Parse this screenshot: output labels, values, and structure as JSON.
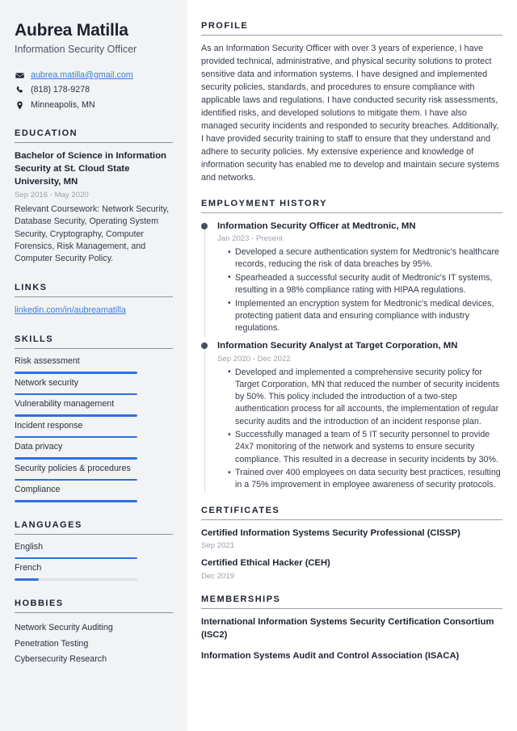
{
  "header": {
    "name": "Aubrea Matilla",
    "job_title": "Information Security Officer",
    "contacts": [
      {
        "icon": "envelope-icon",
        "text": "aubrea.matilla@gmail.com",
        "is_link": true
      },
      {
        "icon": "phone-icon",
        "text": "(818) 178-9278",
        "is_link": false
      },
      {
        "icon": "location-pin-icon",
        "text": "Minneapolis, MN",
        "is_link": false
      }
    ]
  },
  "sidebar": {
    "education": {
      "heading": "EDUCATION",
      "items": [
        {
          "title": "Bachelor of Science in Information Security at St. Cloud State University, MN",
          "date": "Sep 2016 - May 2020",
          "description": "Relevant Coursework: Network Security, Database Security, Operating System Security, Cryptography, Computer Forensics, Risk Management, and Computer Security Policy."
        }
      ]
    },
    "links": {
      "heading": "LINKS",
      "items": [
        {
          "label": "linkedin.com/in/aubreamatilla"
        }
      ]
    },
    "skills": {
      "heading": "SKILLS",
      "items": [
        {
          "label": "Risk assessment",
          "level": 100
        },
        {
          "label": "Network security",
          "level": 100
        },
        {
          "label": "Vulnerability management",
          "level": 100
        },
        {
          "label": "Incident response",
          "level": 100
        },
        {
          "label": "Data privacy",
          "level": 100
        },
        {
          "label": "Security policies & procedures",
          "level": 100
        },
        {
          "label": "Compliance",
          "level": 100
        }
      ]
    },
    "languages": {
      "heading": "LANGUAGES",
      "items": [
        {
          "label": "English",
          "level": 100
        },
        {
          "label": "French",
          "level": 20
        }
      ]
    },
    "hobbies": {
      "heading": "HOBBIES",
      "items": [
        {
          "label": "Network Security Auditing"
        },
        {
          "label": "Penetration Testing"
        },
        {
          "label": "Cybersecurity Research"
        }
      ]
    }
  },
  "main": {
    "profile": {
      "heading": "PROFILE",
      "text": "As an Information Security Officer with over 3 years of experience, I have provided technical, administrative, and physical security solutions to protect sensitive data and information systems. I have designed and implemented security policies, standards, and procedures to ensure compliance with applicable laws and regulations. I have conducted security risk assessments, identified risks, and developed solutions to mitigate them. I have also managed security incidents and responded to security breaches. Additionally, I have provided security training to staff to ensure that they understand and adhere to security policies. My extensive experience and knowledge of information security has enabled me to develop and maintain secure systems and networks."
    },
    "employment": {
      "heading": "EMPLOYMENT HISTORY",
      "jobs": [
        {
          "role": "Information Security Officer at Medtronic, MN",
          "date": "Jan 2023 - Present",
          "bullets": [
            "Developed a secure authentication system for Medtronic's healthcare records, reducing the risk of data breaches by 95%.",
            "Spearheaded a successful security audit of Medtronic's IT systems, resulting in a 98% compliance rating with HIPAA regulations.",
            "Implemented an encryption system for Medtronic's medical devices, protecting patient data and ensuring compliance with industry regulations."
          ]
        },
        {
          "role": "Information Security Analyst at Target Corporation, MN",
          "date": "Sep 2020 - Dec 2022",
          "bullets": [
            "Developed and implemented a comprehensive security policy for Target Corporation, MN that reduced the number of security incidents by 50%. This policy included the introduction of a two-step authentication process for all accounts, the implementation of regular security audits and the introduction of an incident response plan.",
            "Successfully managed a team of 5 IT security personnel to provide 24x7 monitoring of the network and systems to ensure security compliance. This resulted in a decrease in security incidents by 30%.",
            "Trained over 400 employees on data security best practices, resulting in a 75% improvement in employee awareness of security protocols."
          ]
        }
      ]
    },
    "certificates": {
      "heading": "CERTIFICATES",
      "items": [
        {
          "title": "Certified Information Systems Security Professional (CISSP)",
          "date": "Sep 2021"
        },
        {
          "title": "Certified Ethical Hacker (CEH)",
          "date": "Dec 2019"
        }
      ]
    },
    "memberships": {
      "heading": "MEMBERSHIPS",
      "items": [
        {
          "title": "International Information Systems Security Certification Consortium (ISC2)"
        },
        {
          "title": "Information Systems Audit and Control Association (ISACA)"
        }
      ]
    }
  },
  "colors": {
    "accent": "#2f6fe4",
    "link": "#3b7ddd",
    "sidebar_bg": "#f1f3f5",
    "heading": "#1c2230",
    "muted": "#9aa0ab"
  }
}
